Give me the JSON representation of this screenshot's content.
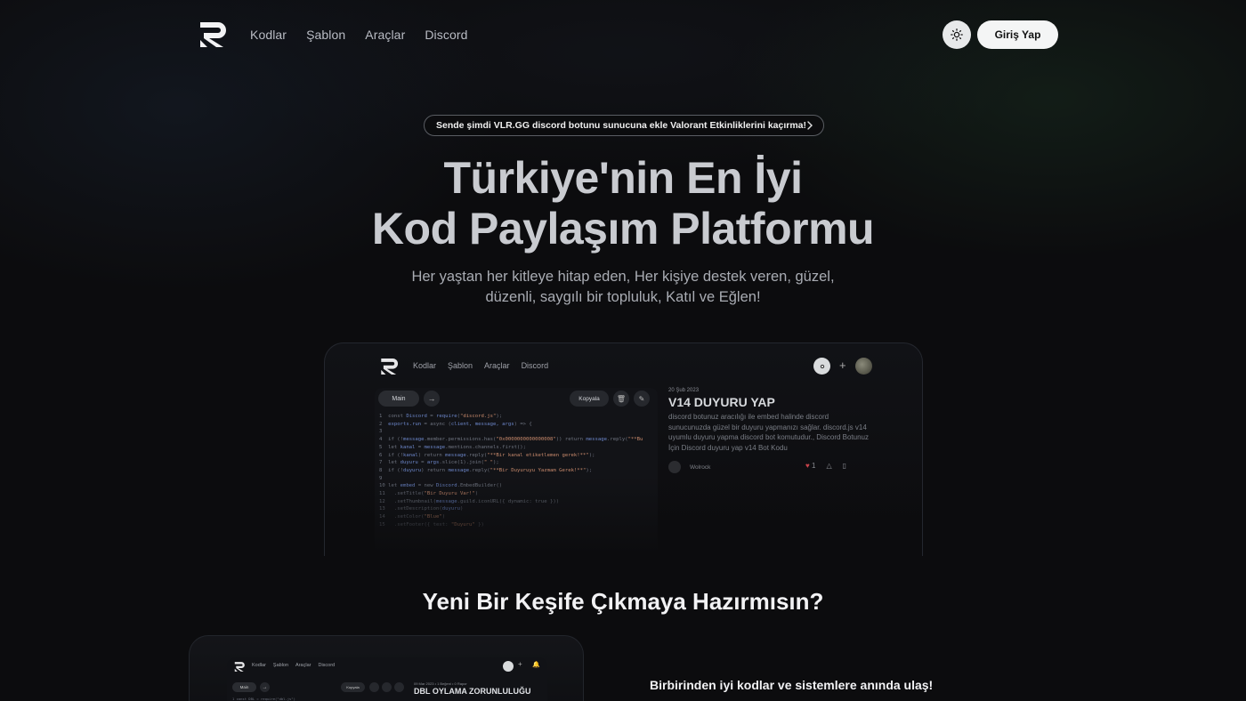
{
  "nav": {
    "links": [
      "Kodlar",
      "Şablon",
      "Araçlar",
      "Discord"
    ],
    "login_label": "Giriş Yap"
  },
  "announcement": {
    "text": "Sende şimdi VLR.GG discord botunu sunucuna ekle Valorant Etkinliklerini kaçırma!"
  },
  "hero": {
    "title_line1": "Türkiye'nin En İyi",
    "title_line2": "Kod Paylaşım Platformu",
    "subtitle_line1": "Her yaştan her kitleye hitap eden, Her kişiye destek veren, güzel,",
    "subtitle_line2": "düzenli, saygılı bir topluluk, Katıl ve Eğlen!"
  },
  "preview": {
    "links": [
      "Kodlar",
      "Şablon",
      "Araçlar",
      "Discord"
    ],
    "tab_label": "Main",
    "copy_label": "Kopyala",
    "card": {
      "date": "20 Şub 2023",
      "title": "V14 DUYURU YAP",
      "description": "discord botunuz aracılığı ile embed halinde discord sunucunuzda güzel bir duyuru yapmanızı sağlar. discord.js v14 uyumlu duyuru yapma discord bot komutudur., Discord Botunuz İçin Discord duyuru yap v14 Bot Kodu",
      "author": "Wolrock",
      "likes": "1"
    }
  },
  "section": {
    "title": "Yeni Bir Keşife Çıkmaya Hazırmısın?"
  },
  "mini_preview": {
    "links": [
      "Kodlar",
      "Şablon",
      "Araçlar",
      "Discord"
    ],
    "tab_label": "Main",
    "copy_label": "Kopyala",
    "date": "09 Mar 2023 • 1 Beğeni • 0 Rapor",
    "title": "DBL OYLAMA ZORUNLULUĞU"
  },
  "feature": {
    "title": "Birbirinden iyi kodlar ve sistemlere anında ulaş!"
  },
  "colors": {
    "background": "#0c0c0e",
    "accent_light": "#f4f5f5",
    "heart": "#c8434b"
  }
}
